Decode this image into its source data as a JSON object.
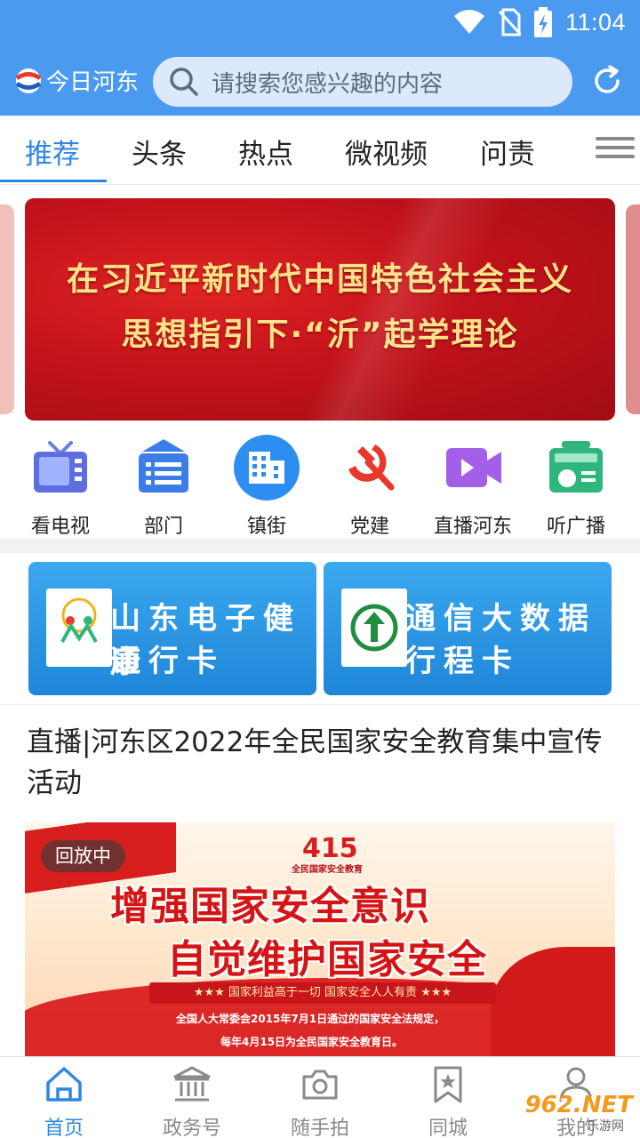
{
  "status_bar": {
    "time": "11:04"
  },
  "header": {
    "app_name": "今日河东",
    "search_placeholder": "请搜索您感兴趣的内容",
    "brand_color": "#4a9bf0"
  },
  "tabs": [
    {
      "label": "推荐",
      "active": true
    },
    {
      "label": "头条"
    },
    {
      "label": "热点"
    },
    {
      "label": "微视频"
    },
    {
      "label": "问责"
    }
  ],
  "banner": {
    "line1": "在习近平新时代中国特色社会主义",
    "line2": "思想指引下·“沂”起学理论"
  },
  "quick_nav": [
    {
      "label": "看电视",
      "icon": "tv-icon"
    },
    {
      "label": "部门",
      "icon": "department-icon"
    },
    {
      "label": "镇街",
      "icon": "building-icon"
    },
    {
      "label": "党建",
      "icon": "party-emblem-icon"
    },
    {
      "label": "直播河东",
      "icon": "video-camera-icon"
    },
    {
      "label": "听广播",
      "icon": "radio-icon"
    }
  ],
  "service_cards": [
    {
      "line1": "山东电子健康",
      "line2": "通行卡"
    },
    {
      "line1": "通信大数据",
      "line2": "行程卡"
    }
  ],
  "article": {
    "title": "直播|河东区2022年全民国家安全教育集中宣传活动",
    "badge": "回放中",
    "image_text": {
      "number": "415",
      "sub": "全民国家安全教育",
      "headline1": "增强国家安全意识",
      "headline2": "自觉维护国家安全",
      "bar": "★★★   国家利益高于一切  国家安全人人有责   ★★★",
      "para1": "全国人大常委会2015年7月1日通过的国家安全法规定，",
      "para2": "每年4月15日为全民国家安全教育日。"
    }
  },
  "bottom_nav": [
    {
      "label": "首页",
      "icon": "home-icon",
      "active": true
    },
    {
      "label": "政务号",
      "icon": "government-building-icon"
    },
    {
      "label": "随手拍",
      "icon": "camera-icon"
    },
    {
      "label": "同城",
      "icon": "bookmark-star-icon"
    },
    {
      "label": "我的",
      "icon": "user-icon"
    }
  ],
  "watermark": {
    "text": "962.NET",
    "sub": "乐游网"
  }
}
